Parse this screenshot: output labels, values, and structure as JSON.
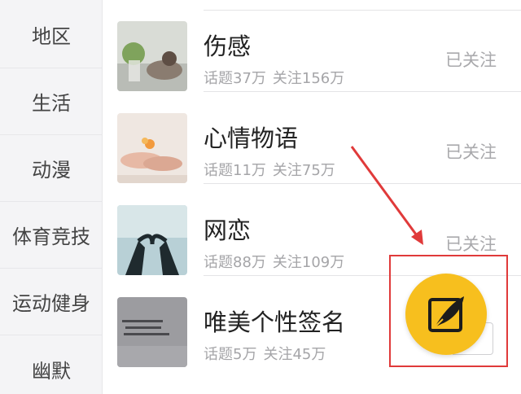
{
  "sidebar": {
    "categories": [
      {
        "label": "地区"
      },
      {
        "label": "生活"
      },
      {
        "label": "动漫"
      },
      {
        "label": "体育竞技"
      },
      {
        "label": "运动健身"
      },
      {
        "label": "幽默"
      }
    ]
  },
  "topics": [
    {
      "name": "伤感",
      "topics_stat": "话题37万",
      "followers_stat": "关注156万",
      "follow_label": "已关注"
    },
    {
      "name": "心情物语",
      "topics_stat": "话题11万",
      "followers_stat": "关注75万",
      "follow_label": "已关注"
    },
    {
      "name": "网恋",
      "topics_stat": "话题88万",
      "followers_stat": "关注109万",
      "follow_label": "已关注"
    },
    {
      "name": "唯美个性签名",
      "topics_stat": "话题5万",
      "followers_stat": "关注45万",
      "follow_label": ""
    }
  ],
  "fab": {
    "icon": "quill-pen-icon",
    "color": "#f7bf1e"
  },
  "annotation": {
    "color": "#e03a3a"
  }
}
